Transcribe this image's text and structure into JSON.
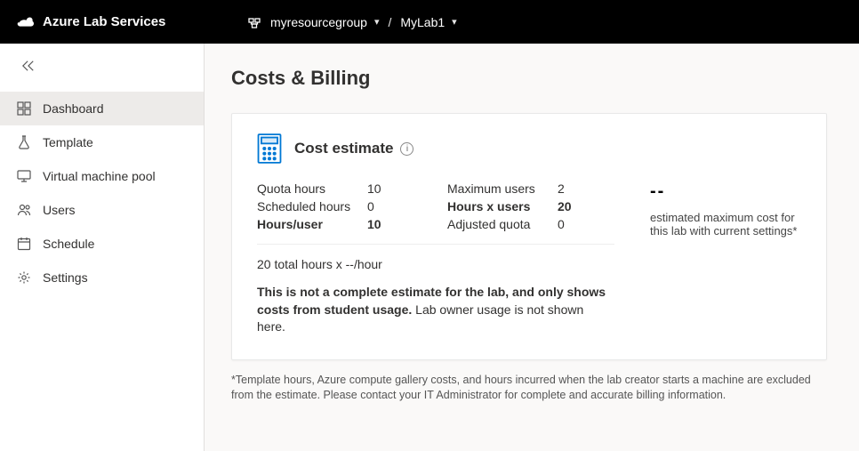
{
  "header": {
    "brand": "Azure Lab Services",
    "resource_group": "myresourcegroup",
    "lab_name": "MyLab1"
  },
  "sidebar": {
    "items": [
      {
        "id": "dashboard",
        "label": "Dashboard",
        "active": true
      },
      {
        "id": "template",
        "label": "Template",
        "active": false
      },
      {
        "id": "vm-pool",
        "label": "Virtual machine pool",
        "active": false
      },
      {
        "id": "users",
        "label": "Users",
        "active": false
      },
      {
        "id": "schedule",
        "label": "Schedule",
        "active": false
      },
      {
        "id": "settings",
        "label": "Settings",
        "active": false
      }
    ]
  },
  "page": {
    "title": "Costs & Billing",
    "card_title": "Cost estimate",
    "metrics": {
      "quota_hours_label": "Quota hours",
      "quota_hours_value": "10",
      "scheduled_hours_label": "Scheduled hours",
      "scheduled_hours_value": "0",
      "hours_per_user_label": "Hours/user",
      "hours_per_user_value": "10",
      "max_users_label": "Maximum users",
      "max_users_value": "2",
      "hours_x_users_label": "Hours x users",
      "hours_x_users_value": "20",
      "adjusted_quota_label": "Adjusted quota",
      "adjusted_quota_value": "0"
    },
    "rate_line": "20 total hours x --/hour",
    "disclaimer_bold": "This is not a complete estimate for the lab, and only shows costs from student usage.",
    "disclaimer_rest": " Lab owner usage is not shown here.",
    "estimate_value": "--",
    "estimate_caption": "estimated maximum cost for this lab with current settings*",
    "footnote": "*Template hours, Azure compute gallery costs, and hours incurred when the lab creator starts a machine are excluded from the estimate. Please contact your IT Administrator for complete and accurate billing information."
  }
}
